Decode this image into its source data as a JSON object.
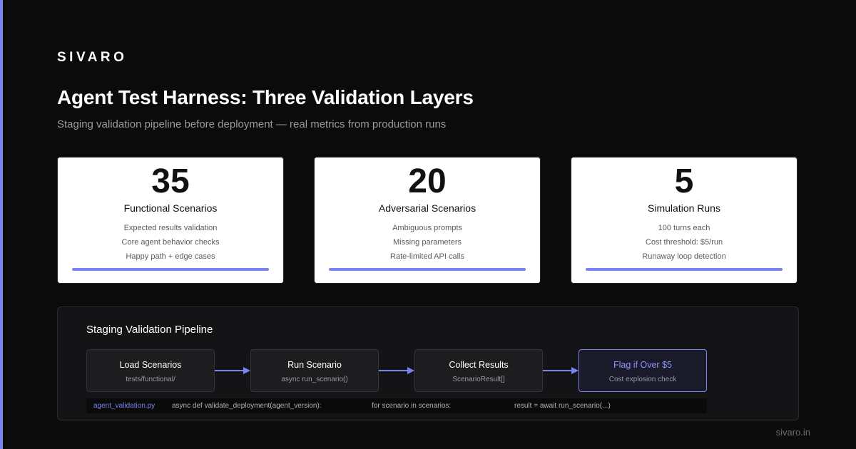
{
  "brand": "SIVARO",
  "title": "Agent Test Harness: Three Validation Layers",
  "subtitle": "Staging validation pipeline before deployment — real metrics from production runs",
  "colors": {
    "accent": "#7b83f0",
    "background": "#0b0b0b",
    "card_bg": "#ffffff"
  },
  "cards": [
    {
      "number": "35",
      "label": "Functional Scenarios",
      "details": [
        "Expected results validation",
        "Core agent behavior checks",
        "Happy path + edge cases"
      ]
    },
    {
      "number": "20",
      "label": "Adversarial Scenarios",
      "details": [
        "Ambiguous prompts",
        "Missing parameters",
        "Rate-limited API calls"
      ]
    },
    {
      "number": "5",
      "label": "Simulation Runs",
      "details": [
        "100 turns each",
        "Cost threshold: $5/run",
        "Runaway loop detection"
      ]
    }
  ],
  "pipeline": {
    "title": "Staging Validation Pipeline",
    "steps": [
      {
        "label": "Load Scenarios",
        "sub": "tests/functional/"
      },
      {
        "label": "Run Scenario",
        "sub": "async run_scenario()"
      },
      {
        "label": "Collect Results",
        "sub": "ScenarioResult[]"
      },
      {
        "label": "Flag if Over $5",
        "sub": "Cost explosion check"
      }
    ],
    "code": {
      "file": "agent_validation.py",
      "parts": [
        "async def validate_deployment(agent_version):",
        "for scenario in scenarios:",
        "result = await run_scenario(...)"
      ]
    }
  },
  "footer": "sivaro.in"
}
